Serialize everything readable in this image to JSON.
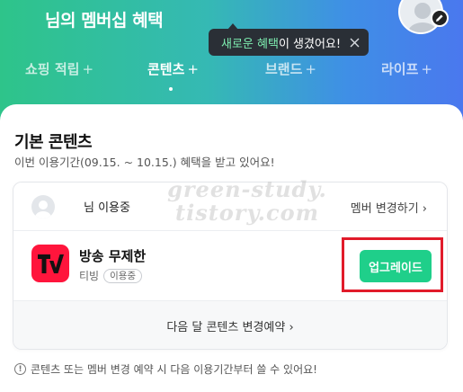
{
  "header": {
    "title": "님의 멤버십 혜택"
  },
  "tooltip": {
    "highlight": "새로운 혜택",
    "text": "이 생겼어요!"
  },
  "tabs": [
    {
      "label": "쇼핑 적립",
      "plus": "+"
    },
    {
      "label": "콘텐츠",
      "plus": "+"
    },
    {
      "label": "브랜드",
      "plus": "+"
    },
    {
      "label": "라이프",
      "plus": "+"
    }
  ],
  "section": {
    "title": "기본 콘텐츠",
    "subtitle": "이번 이용기간(09.15. ~ 10.15.) 혜택을 받고 있어요!"
  },
  "card": {
    "user_name": "님 이용중",
    "member_change": "멤버 변경하기 ›",
    "service_name": "방송 무제한",
    "service_provider": "티빙",
    "service_badge": "이용중",
    "upgrade_label": "업그레이드",
    "reserve_label": "다음 달 콘텐츠 변경예약 ›"
  },
  "notice": {
    "icon": "!",
    "text": "콘텐츠 또는 멤버 변경 예약 시 다음 이용기간부터 쓸 수 있어요!"
  },
  "watermark": {
    "line1": "green-study.",
    "line2": "tistory.com"
  },
  "colors": {
    "accent_green": "#1fcf8a",
    "highlight_box": "#e11b2a",
    "tving_red": "#ff153c"
  }
}
